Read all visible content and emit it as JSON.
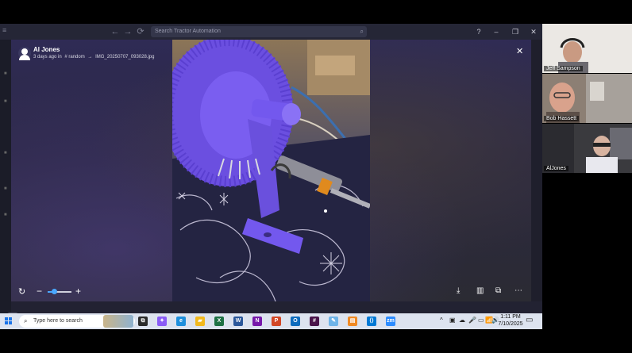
{
  "app": {
    "search_placeholder": "Search Tractor Automation",
    "window_controls": [
      "?",
      "–",
      "❐",
      "✕"
    ],
    "nav": [
      "←",
      "→",
      "⟳"
    ]
  },
  "viewer": {
    "author": "Al Jones",
    "meta_time": "3 days ago in",
    "meta_channel": "# random",
    "meta_arrow": "→",
    "meta_file": "IMG_20250707_093028.jpg",
    "close_glyph": "✕",
    "rotate_glyph": "↻",
    "zoom_minus": "−",
    "zoom_plus": "+",
    "zoom_level": 0.25,
    "tool_glyphs": {
      "download": "⤓",
      "panel": "▥",
      "copy": "⧉",
      "more": "⋯"
    }
  },
  "taskbar": {
    "search_placeholder": "Type here to search",
    "time": "1:11 PM",
    "date": "7/10/2025",
    "apps": [
      {
        "name": "task-view",
        "glyph": "⧉",
        "color": "#2b2b2b"
      },
      {
        "name": "copilot",
        "glyph": "✦",
        "color": "#8a5cf6"
      },
      {
        "name": "edge",
        "glyph": "e",
        "color": "#1f8fdc"
      },
      {
        "name": "file-explorer",
        "glyph": "▰",
        "color": "#f2b91e"
      },
      {
        "name": "excel",
        "glyph": "X",
        "color": "#1e7145"
      },
      {
        "name": "word",
        "glyph": "W",
        "color": "#2b579a"
      },
      {
        "name": "onenote",
        "glyph": "N",
        "color": "#7719aa"
      },
      {
        "name": "powerpoint",
        "glyph": "P",
        "color": "#d24726"
      },
      {
        "name": "outlook",
        "glyph": "O",
        "color": "#0f6cbd"
      },
      {
        "name": "slack",
        "glyph": "#",
        "color": "#4a154b"
      },
      {
        "name": "paint",
        "glyph": "✎",
        "color": "#6fb4e8"
      },
      {
        "name": "notes",
        "glyph": "▤",
        "color": "#f08a24"
      },
      {
        "name": "vscode",
        "glyph": "⟨⟩",
        "color": "#0078d4"
      },
      {
        "name": "zoom",
        "glyph": "zm",
        "color": "#2d8cff"
      }
    ],
    "tray_glyphs": [
      "^",
      "▣",
      "☁",
      "🎤",
      "▭",
      "📶",
      "🔊"
    ]
  },
  "participants": [
    {
      "name": "Jeff Sampson"
    },
    {
      "name": "Bob Hassett"
    },
    {
      "name": "AlJones"
    }
  ]
}
